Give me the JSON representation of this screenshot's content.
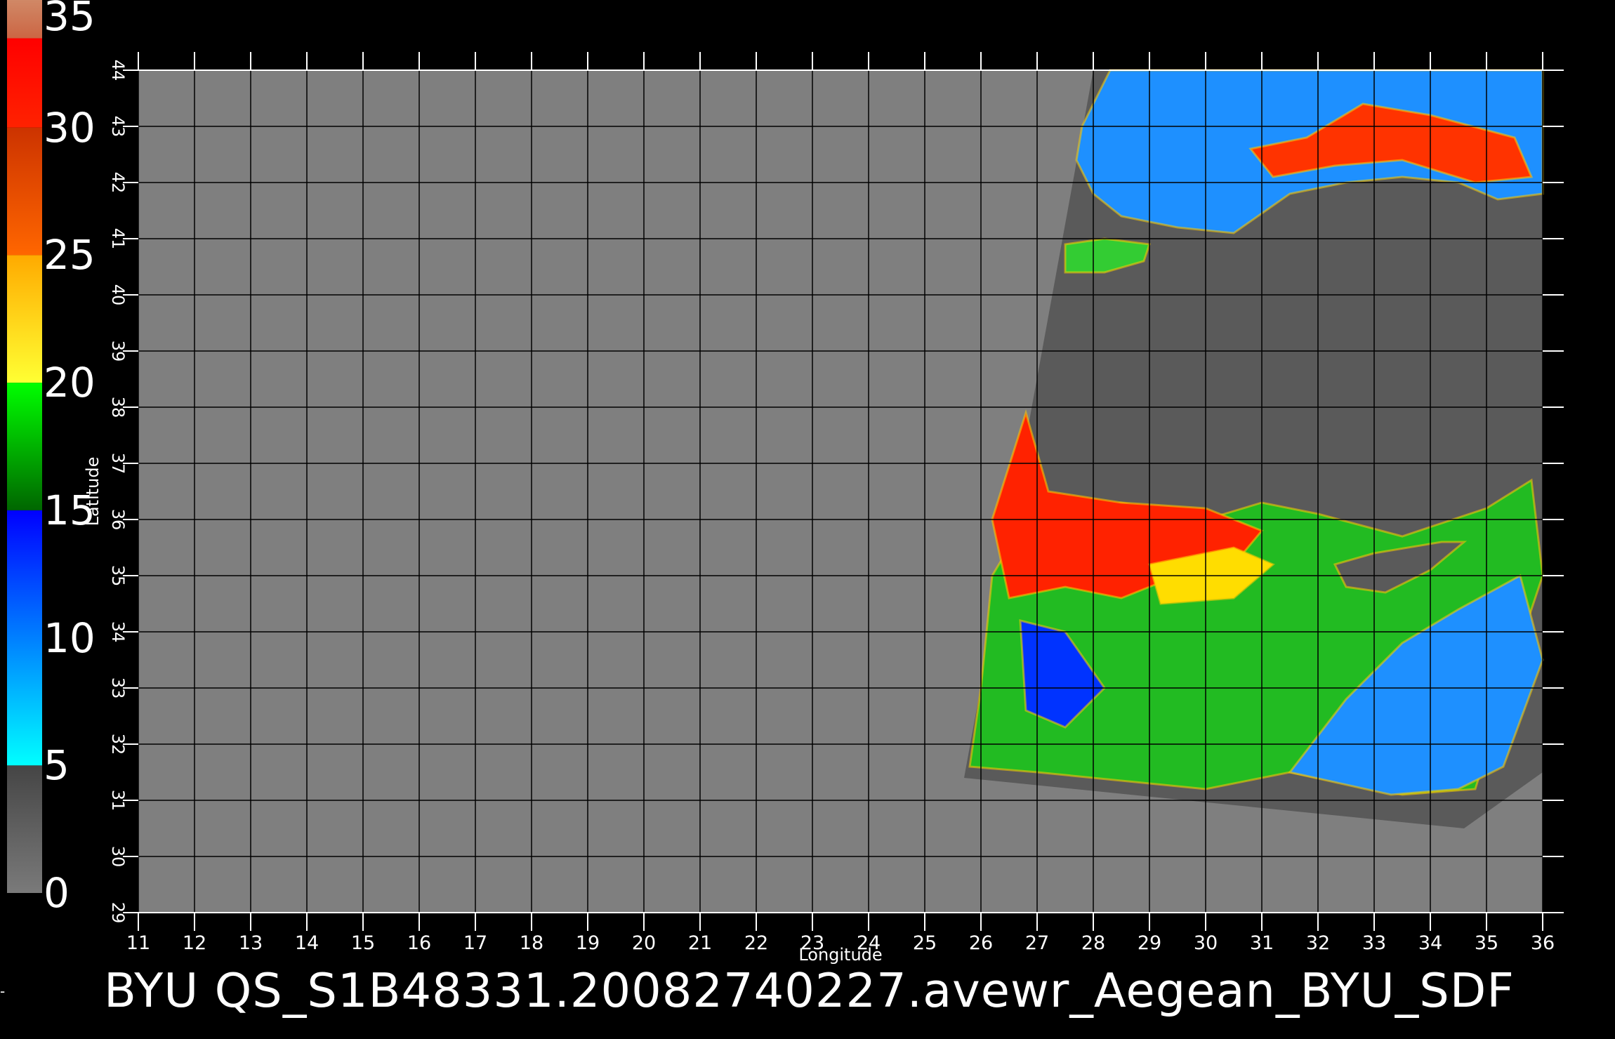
{
  "title": "BYU  QS_S1B48331.20082740227.avewr_Aegean_BYU_SDF",
  "left_mark": "-",
  "colorbar": {
    "labels": [
      "35",
      "30",
      "25",
      "20",
      "15",
      "10",
      "5",
      "0"
    ],
    "range": [
      0,
      35
    ],
    "segments": [
      {
        "from": 0,
        "to": 5,
        "colors": [
          "#7a7a7a",
          "#454545"
        ]
      },
      {
        "from": 5,
        "to": 15,
        "colors": [
          "#00ffff",
          "#0000ff"
        ]
      },
      {
        "from": 15,
        "to": 20,
        "colors": [
          "#006600",
          "#00ff00"
        ]
      },
      {
        "from": 20,
        "to": 25,
        "colors": [
          "#ffff33",
          "#ffaa00"
        ]
      },
      {
        "from": 25,
        "to": 30,
        "colors": [
          "#ff6600",
          "#cc3300"
        ]
      },
      {
        "from": 30,
        "to": 33.5,
        "colors": [
          "#ff2200",
          "#ff0000"
        ]
      },
      {
        "from": 33.5,
        "to": 35,
        "colors": [
          "#cc6644",
          "#d08866"
        ]
      }
    ]
  },
  "axes": {
    "xlabel": "Longitude",
    "ylabel": "Latitude",
    "xlim": [
      11,
      36
    ],
    "ylim": [
      29,
      44
    ],
    "xticks": [
      11,
      12,
      13,
      14,
      15,
      16,
      17,
      18,
      19,
      20,
      21,
      22,
      23,
      24,
      25,
      26,
      27,
      28,
      29,
      30,
      31,
      32,
      33,
      34,
      35,
      36
    ],
    "yticks": [
      29,
      30,
      31,
      32,
      33,
      34,
      35,
      36,
      37,
      38,
      39,
      40,
      41,
      42,
      43,
      44
    ],
    "grid": true,
    "background": "#7f7f7f",
    "swath_color": "#5a5a5a"
  },
  "regions": [
    {
      "name": "black-sea-wind-field",
      "points": [
        [
          27.8,
          43.0
        ],
        [
          28.3,
          44.0
        ],
        [
          36.0,
          44.0
        ],
        [
          36.0,
          41.8
        ],
        [
          35.2,
          41.7
        ],
        [
          34.5,
          42.0
        ],
        [
          33.5,
          42.1
        ],
        [
          32.5,
          42.0
        ],
        [
          31.5,
          41.8
        ],
        [
          30.5,
          41.1
        ],
        [
          29.5,
          41.2
        ],
        [
          28.5,
          41.4
        ],
        [
          28.0,
          41.8
        ],
        [
          27.7,
          42.4
        ]
      ],
      "color": "#1e90ff"
    },
    {
      "name": "black-sea-high-wind",
      "points": [
        [
          30.8,
          42.6
        ],
        [
          31.8,
          42.8
        ],
        [
          32.8,
          43.4
        ],
        [
          34.0,
          43.2
        ],
        [
          35.5,
          42.8
        ],
        [
          35.8,
          42.1
        ],
        [
          34.8,
          42.0
        ],
        [
          33.5,
          42.4
        ],
        [
          32.3,
          42.3
        ],
        [
          31.2,
          42.1
        ]
      ],
      "color": "#ff3300"
    },
    {
      "name": "marmara-wind-field",
      "points": [
        [
          27.5,
          40.9
        ],
        [
          28.2,
          41.0
        ],
        [
          29.0,
          40.9
        ],
        [
          28.9,
          40.6
        ],
        [
          28.2,
          40.4
        ],
        [
          27.5,
          40.4
        ]
      ],
      "color": "#33cc33"
    },
    {
      "name": "med-green-wind-field",
      "points": [
        [
          25.8,
          31.6
        ],
        [
          26.0,
          33.0
        ],
        [
          26.2,
          35.0
        ],
        [
          26.8,
          36.0
        ],
        [
          28.5,
          36.3
        ],
        [
          30.0,
          36.0
        ],
        [
          31.0,
          36.3
        ],
        [
          32.0,
          36.1
        ],
        [
          33.5,
          35.7
        ],
        [
          35.0,
          36.2
        ],
        [
          35.8,
          36.7
        ],
        [
          36.0,
          35.0
        ],
        [
          35.5,
          33.5
        ],
        [
          34.8,
          31.2
        ],
        [
          33.5,
          31.1
        ],
        [
          31.5,
          31.5
        ],
        [
          30.0,
          31.2
        ],
        [
          27.0,
          31.5
        ]
      ],
      "color": "#22bb22"
    },
    {
      "name": "med-red-wind-field",
      "points": [
        [
          26.8,
          37.9
        ],
        [
          27.2,
          36.5
        ],
        [
          28.5,
          36.3
        ],
        [
          30.0,
          36.2
        ],
        [
          31.0,
          35.8
        ],
        [
          30.5,
          35.2
        ],
        [
          29.5,
          35.0
        ],
        [
          28.5,
          34.6
        ],
        [
          27.5,
          34.8
        ],
        [
          26.5,
          34.6
        ],
        [
          26.2,
          36.0
        ]
      ],
      "color": "#ff2200"
    },
    {
      "name": "med-yellow-wind-field",
      "points": [
        [
          29.0,
          35.2
        ],
        [
          30.5,
          35.5
        ],
        [
          31.2,
          35.2
        ],
        [
          30.5,
          34.6
        ],
        [
          29.2,
          34.5
        ]
      ],
      "color": "#ffdd00"
    },
    {
      "name": "med-blue-wind-field-east",
      "points": [
        [
          31.5,
          31.5
        ],
        [
          32.5,
          32.8
        ],
        [
          33.5,
          33.8
        ],
        [
          34.5,
          34.4
        ],
        [
          35.6,
          35.0
        ],
        [
          36.0,
          33.5
        ],
        [
          35.3,
          31.6
        ],
        [
          34.5,
          31.2
        ],
        [
          33.3,
          31.1
        ]
      ],
      "color": "#1e90ff"
    },
    {
      "name": "med-blue-wind-field-west",
      "points": [
        [
          26.7,
          34.2
        ],
        [
          27.5,
          34.0
        ],
        [
          28.2,
          33.0
        ],
        [
          27.5,
          32.3
        ],
        [
          26.8,
          32.6
        ]
      ],
      "color": "#0033ff"
    },
    {
      "name": "cyprus-land",
      "points": [
        [
          32.3,
          35.2
        ],
        [
          33.0,
          35.4
        ],
        [
          34.2,
          35.6
        ],
        [
          34.6,
          35.6
        ],
        [
          34.0,
          35.1
        ],
        [
          33.2,
          34.7
        ],
        [
          32.5,
          34.8
        ]
      ],
      "color": "#5a5a5a"
    }
  ]
}
